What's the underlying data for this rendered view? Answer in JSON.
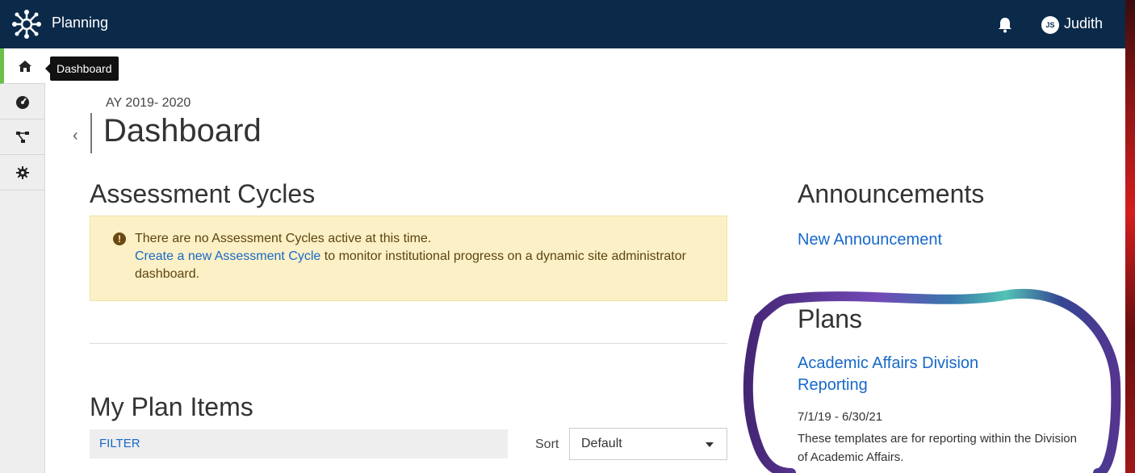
{
  "topbar": {
    "app_title": "Planning",
    "user_initials": "JS",
    "user_name": "Judith"
  },
  "sidebar": {
    "items": [
      {
        "icon": "home-icon",
        "active": true
      },
      {
        "icon": "dashboard-gauge-icon",
        "active": false
      },
      {
        "icon": "hierarchy-icon",
        "active": false
      },
      {
        "icon": "gear-icon",
        "active": false
      }
    ],
    "tooltip": "Dashboard"
  },
  "header": {
    "academic_year": "AY 2019- 2020",
    "title": "Dashboard"
  },
  "assessment_cycles": {
    "heading": "Assessment Cycles",
    "alert_message": "There are no Assessment Cycles active at this time.",
    "alert_link": "Create a new Assessment Cycle",
    "alert_rest": " to monitor institutional progress on a dynamic site administrator dashboard."
  },
  "my_plan_items": {
    "heading": "My Plan Items",
    "filter_label": "FILTER",
    "sort_label": "Sort",
    "sort_value": "Default"
  },
  "announcements": {
    "heading": "Announcements",
    "new_link": "New Announcement"
  },
  "plans": {
    "heading": "Plans",
    "items": [
      {
        "title_line1": "Academic Affairs Division",
        "title_line2": "Reporting",
        "dates": "7/1/19 - 6/30/21",
        "description": "These templates are for reporting within the Division of Academic Affairs."
      }
    ]
  },
  "colors": {
    "topbar": "#0b2a4a",
    "link": "#1669c9",
    "alert_bg": "#fcf0c6",
    "active_accent": "#6cc04a"
  }
}
